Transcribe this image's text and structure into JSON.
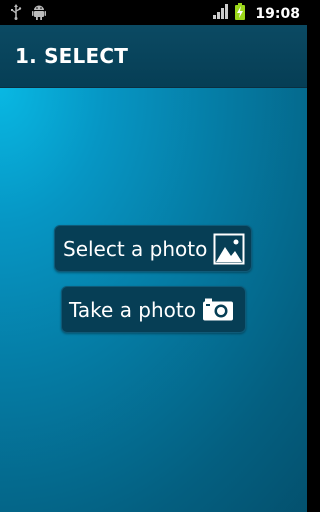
{
  "status_bar": {
    "time": "19:08",
    "icons": [
      "usb-icon",
      "android-debug-icon",
      "signal-icon",
      "battery-charging-icon"
    ]
  },
  "header": {
    "title": "1. SELECT"
  },
  "actions": {
    "select_photo_label": "Select a photo",
    "select_photo_icon": "image-icon",
    "take_photo_label": "Take a photo",
    "take_photo_icon": "camera-icon"
  },
  "colors": {
    "header_bg": "#063e55",
    "button_bg": "#063e55",
    "background_light": "#09b8e3",
    "background_dark": "#034c68"
  }
}
